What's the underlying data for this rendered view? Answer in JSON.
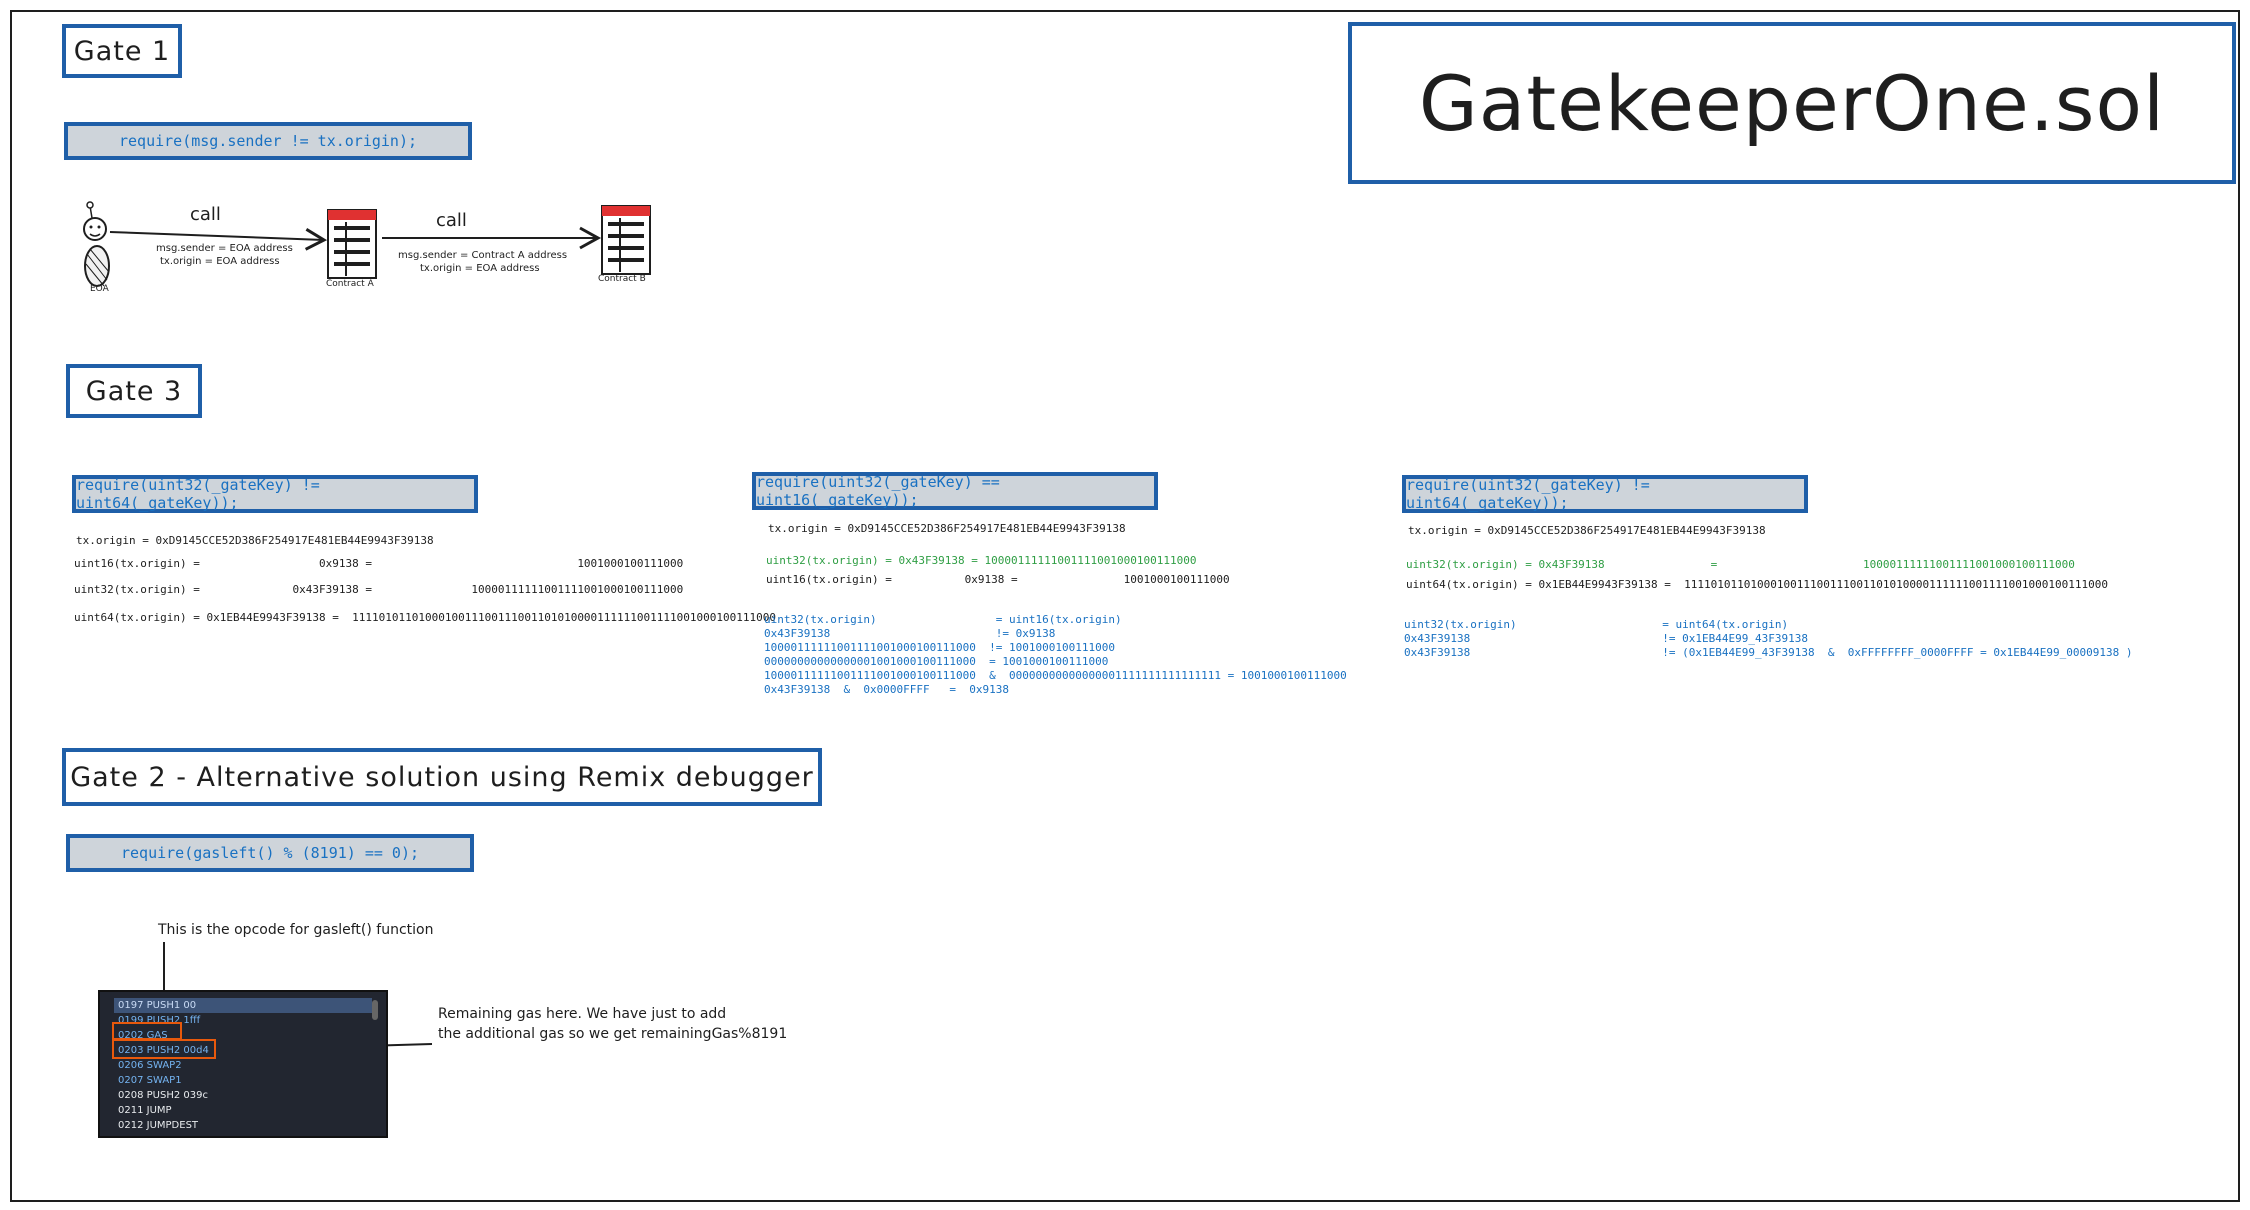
{
  "title": "GatekeeperOne.sol",
  "gate1": {
    "title": "Gate 1",
    "require": "require(msg.sender != tx.origin);",
    "eoa_label": "EOA",
    "contract_a_label": "Contract A",
    "contract_b_label": "Contract B",
    "call1_label": "call",
    "call2_label": "call",
    "call1_line1": "msg.sender = EOA address",
    "call1_line2": "tx.origin = EOA address",
    "call2_line1": "msg.sender = Contract A address",
    "call2_line2": "tx.origin = EOA address"
  },
  "gate3": {
    "title": "Gate 3",
    "col1": {
      "require": "require(uint32(_gateKey) != uint64(_gateKey));",
      "lines": [
        "tx.origin = 0xD9145CCE52D386F254917E481EB44E9943F39138",
        "uint16(tx.origin) =                  0x9138 =                               1001000100111000",
        "uint32(tx.origin) =              0x43F39138 =               10000111111001111001000100111000",
        "uint64(tx.origin) = 0x1EB44E9943F39138 =  1111010110100010011100111001101010000111111001111001000100111000"
      ]
    },
    "col2": {
      "require": "require(uint32(_gateKey) == uint16(_gateKey));",
      "origin": "tx.origin = 0xD9145CCE52D386F254917E481EB44E9943F39138",
      "line_green": "uint32(tx.origin) = 0x43F39138 = 10000111111001111001000100111000",
      "line_black": "uint16(tx.origin) =           0x9138 =                1001000100111000",
      "blue_lines": [
        "uint32(tx.origin)                  = uint16(tx.origin)",
        "0x43F39138                         != 0x9138",
        "10000111111001111001000100111000  != 1001000100111000",
        "00000000000000001001000100111000  = 1001000100111000",
        "10000111111001111001000100111000  &  00000000000000001111111111111111 = 1001000100111000",
        "0x43F39138  &  0x0000FFFF   =  0x9138"
      ]
    },
    "col3": {
      "require": "require(uint32(_gateKey) != uint64(_gateKey));",
      "origin": "tx.origin = 0xD9145CCE52D386F254917E481EB44E9943F39138",
      "line_green": "uint32(tx.origin) = 0x43F39138                =                      10000111111001111001000100111000",
      "line_black": "uint64(tx.origin) = 0x1EB44E9943F39138 =  1111010110100010011100111001101010000111111001111001000100111000",
      "blue_lines": [
        "uint32(tx.origin)                      = uint64(tx.origin)",
        "0x43F39138                             != 0x1EB44E99_43F39138",
        "0x43F39138                             != (0x1EB44E99_43F39138  &  0xFFFFFFFF_0000FFFF = 0x1EB44E99_00009138 )"
      ]
    }
  },
  "gate2": {
    "title": "Gate 2 - Alternative solution using Remix debugger",
    "require": "require(gasleft() % (8191) == 0);",
    "annotation_top": "This is the opcode for gasleft() function",
    "annotation_right_1": "Remaining gas here. We have just to add",
    "annotation_right_2": "the additional gas so we get remainingGas%8191",
    "debugger_rows": [
      "0197 PUSH1 00",
      "0199 PUSH2 1fff",
      "0202 GAS",
      "0203 PUSH2 00d4",
      "0206 SWAP2",
      "0207 SWAP1",
      "0208 PUSH2 039c",
      "0211 JUMP",
      "0212 JUMPDEST"
    ]
  },
  "colors": {
    "box_border": "#1f5fa8",
    "require_fill": "#ced4da",
    "require_text": "#1971c2",
    "green_text": "#2f9e44",
    "highlight": "#e8590c",
    "debugger_bg": "#222630"
  }
}
